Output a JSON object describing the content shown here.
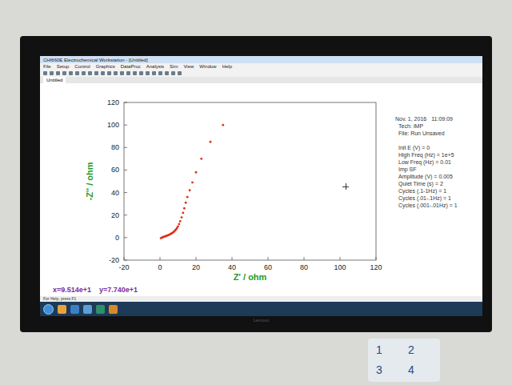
{
  "window": {
    "title": "CHI660E Electrochemical Workstation - [Untitled]"
  },
  "menu": [
    "File",
    "Setup",
    "Control",
    "Graphics",
    "DataProc",
    "Analysis",
    "Sim",
    "View",
    "Window",
    "Help"
  ],
  "tabs": [
    {
      "label": "Untitled",
      "selected": true
    }
  ],
  "chart": {
    "x_label": "Z' / ohm",
    "y_label": "-Z'' / ohm",
    "x_ticks": [
      "-20",
      "0",
      "20",
      "40",
      "60",
      "80",
      "100",
      "120"
    ],
    "y_ticks": [
      "120",
      "100",
      "80",
      "60",
      "40",
      "20",
      "0",
      "-20"
    ],
    "series": [
      {
        "name": "impedance",
        "color": "#e0301e",
        "z_real": [
          0.5,
          1,
          1.5,
          2,
          2.5,
          3,
          3.5,
          4,
          4.5,
          5,
          5.5,
          6,
          6.5,
          7,
          7.5,
          8,
          8.5,
          9,
          9.5,
          10,
          10.6,
          11.2,
          12,
          12.8,
          13.5,
          14.3,
          15.2,
          16.5,
          18,
          20,
          23,
          28,
          35
        ],
        "z_imag_neg": [
          -0.5,
          0,
          0.3,
          0.6,
          0.9,
          1.2,
          1.5,
          1.8,
          2.1,
          2.5,
          2.9,
          3.3,
          3.8,
          4.3,
          4.9,
          5.6,
          6.5,
          7.5,
          8.6,
          10,
          12,
          14.5,
          18,
          22,
          26,
          31,
          36,
          42,
          49,
          58,
          70,
          85,
          100
        ]
      }
    ]
  },
  "info": {
    "date": "Nov. 1, 2016",
    "time": "11:09:09",
    "lines": [
      "Tech: IMP",
      "File: Run Unsaved",
      "",
      "Init E (V) = 0",
      "High Freq (Hz) = 1e+5",
      "Low Freq (Hz) = 0.01",
      "Imp SF",
      "Amplitude (V) = 0.005",
      "Quiet Time (s) = 2",
      "Cycles (.1-1Hz) = 1",
      "Cycles (.01-.1Hz) = 1",
      "Cycles (.001-.01Hz) = 1"
    ]
  },
  "cursor": {
    "x": "x=9.514e+1",
    "y": "y=7.740e+1"
  },
  "status_bar": "For Help, press F1",
  "monitor_brand": "Lenovo",
  "desk_labels": [
    "1",
    "2",
    "3",
    "4"
  ]
}
